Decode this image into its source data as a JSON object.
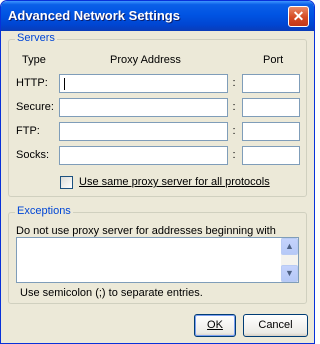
{
  "window": {
    "title": "Advanced Network Settings",
    "close_label": "✕"
  },
  "servers": {
    "legend": "Servers",
    "col_type": "Type",
    "col_address": "Proxy Address",
    "col_port": "Port",
    "separator": ":",
    "rows": [
      {
        "label": "HTTP:",
        "address": "",
        "port": ""
      },
      {
        "label": "Secure:",
        "address": "",
        "port": ""
      },
      {
        "label": "FTP:",
        "address": "",
        "port": ""
      },
      {
        "label": "Socks:",
        "address": "",
        "port": ""
      }
    ],
    "same_proxy_label": "Use same proxy server for all protocols",
    "same_proxy_checked": false
  },
  "exceptions": {
    "legend": "Exceptions",
    "description": "Do not use proxy server for addresses beginning with",
    "value": "",
    "hint": "Use semicolon (;) to separate entries."
  },
  "buttons": {
    "ok": "OK",
    "cancel": "Cancel"
  },
  "colors": {
    "titlebar": "#0054e3",
    "legend": "#0046d5",
    "dialog_bg": "#ece9d8"
  }
}
